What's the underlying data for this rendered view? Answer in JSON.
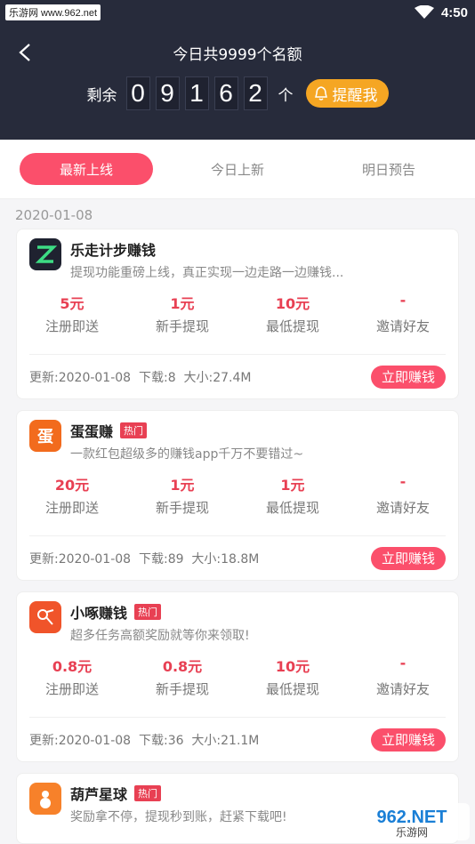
{
  "status": {
    "site": "乐游网 www.962.net",
    "time": "4:50"
  },
  "header": {
    "title": "今日共9999个名额",
    "remaining_label": "剩余",
    "digits": [
      "0",
      "9",
      "1",
      "6",
      "2"
    ],
    "unit": "个",
    "remind_label": "提醒我"
  },
  "tabs": [
    {
      "label": "最新上线",
      "active": true
    },
    {
      "label": "今日上新",
      "active": false
    },
    {
      "label": "明日预告",
      "active": false
    }
  ],
  "date": "2020-01-08",
  "earn_label": "立即赚钱",
  "hot_label": "热门",
  "stat_labels": [
    "注册即送",
    "新手提现",
    "最低提现",
    "邀请好友"
  ],
  "apps": [
    {
      "name": "乐走计步赚钱",
      "hot": false,
      "icon": "z-logo-icon",
      "icon_color": "#1f2230",
      "desc": "提现功能重磅上线，真正实现一边走路一边赚钱...",
      "values": [
        "5元",
        "1元",
        "10元",
        "-"
      ],
      "meta": "更新:2020-01-08  下载:8  大小:27.4M"
    },
    {
      "name": "蛋蛋赚",
      "hot": true,
      "icon": "egg-logo-icon",
      "icon_color": "#f26b1d",
      "icon_text": "蛋",
      "desc": "一款红包超级多的赚钱app千万不要错过~",
      "values": [
        "20元",
        "1元",
        "1元",
        "-"
      ],
      "meta": "更新:2020-01-08  下载:89  大小:18.8M"
    },
    {
      "name": "小啄赚钱",
      "hot": true,
      "icon": "bird-logo-icon",
      "icon_color": "#f0542a",
      "desc": "超多任务高额奖励就等你来领取!",
      "values": [
        "0.8元",
        "0.8元",
        "10元",
        "-"
      ],
      "meta": "更新:2020-01-08  下载:36  大小:21.1M"
    },
    {
      "name": "葫芦星球",
      "hot": true,
      "icon": "gourd-logo-icon",
      "icon_color": "#f7812a",
      "desc": "奖励拿不停，提现秒到账，赶紧下载吧!",
      "values": [],
      "meta": ""
    }
  ],
  "watermark": "962.NET 乐游网"
}
